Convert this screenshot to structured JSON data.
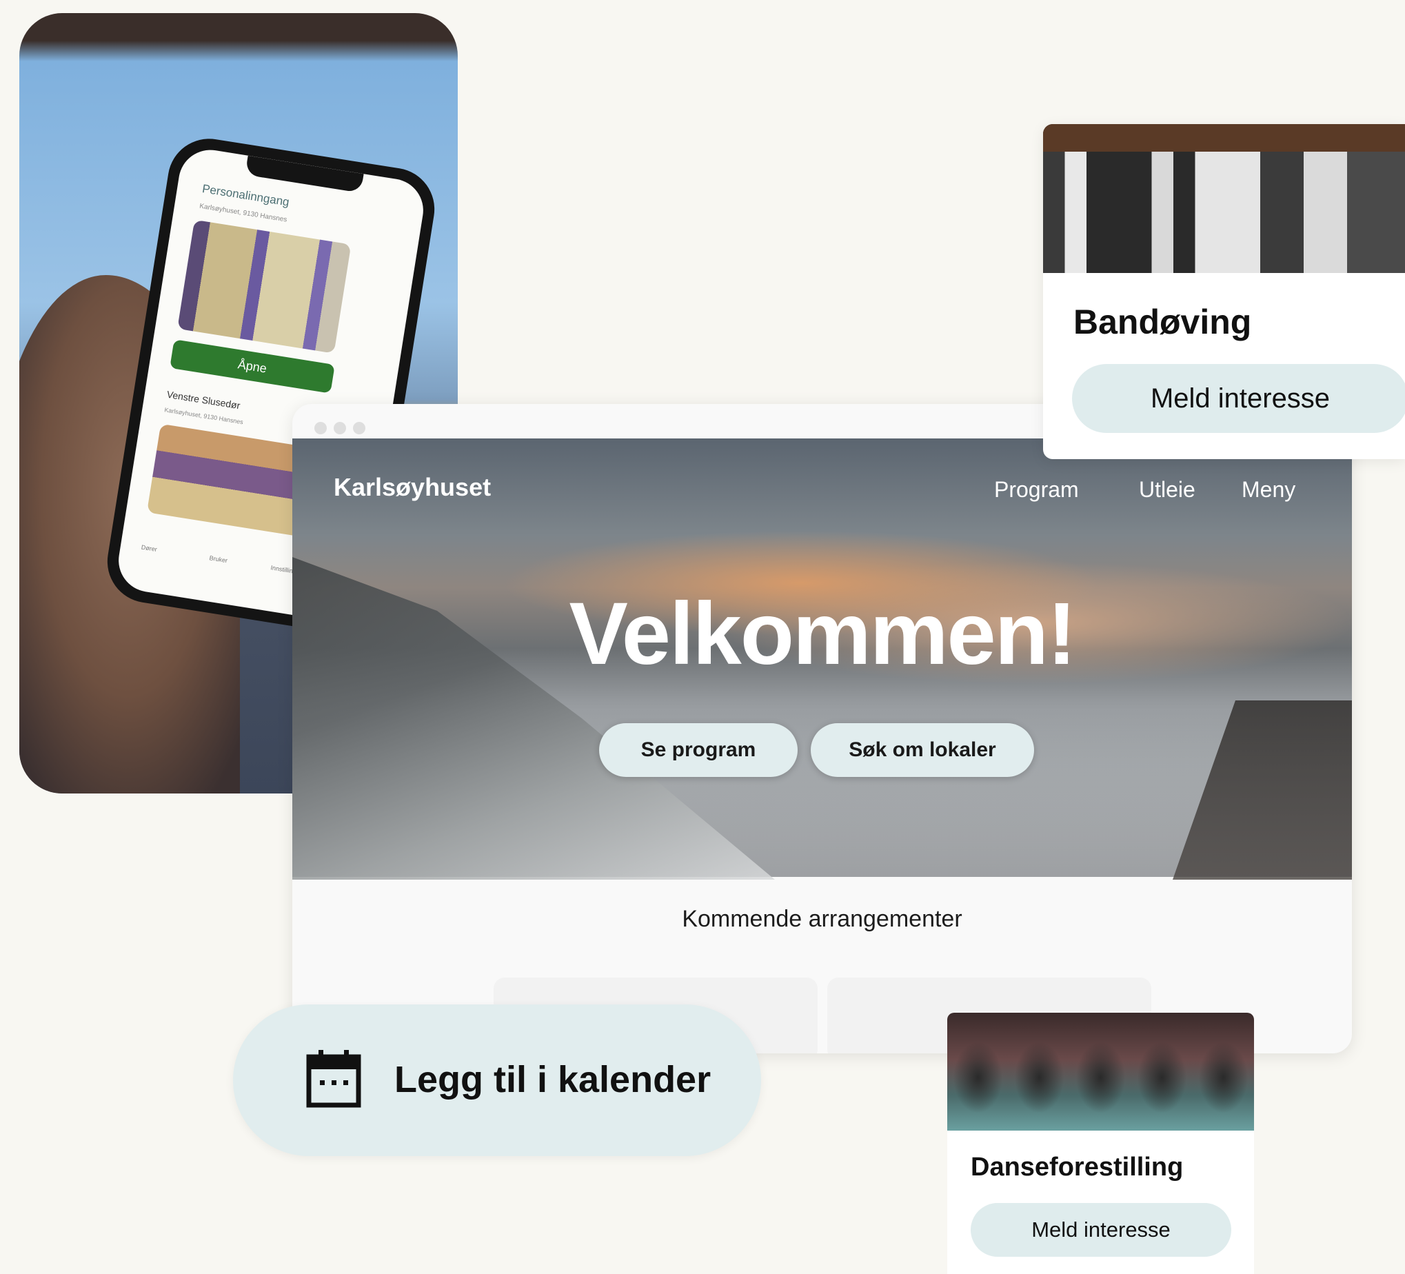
{
  "phone_app": {
    "item1_title": "Personalinngang",
    "item1_address": "Karlsøyhuset, 9130 Hansnes",
    "open_button": "Åpne",
    "item2_title": "Venstre Slusedør",
    "item2_address": "Karlsøyhuset, 9130 Hansnes",
    "tabs": [
      "Dører",
      "Bruker",
      "Innstillinger"
    ]
  },
  "browser": {
    "site_name": "Karlsøyhuset",
    "nav": [
      "Program",
      "Utleie",
      "Meny"
    ],
    "hero_title": "Velkommen!",
    "hero_buttons": [
      "Se program",
      "Søk om lokaler"
    ],
    "upcoming_heading": "Kommende arrangementer"
  },
  "card_band": {
    "title": "Bandøving",
    "button": "Meld interesse"
  },
  "calendar_pill": {
    "icon": "calendar-icon",
    "label": "Legg til i kalender"
  },
  "card_dance": {
    "title": "Danseforestilling",
    "button": "Meld interesse"
  }
}
